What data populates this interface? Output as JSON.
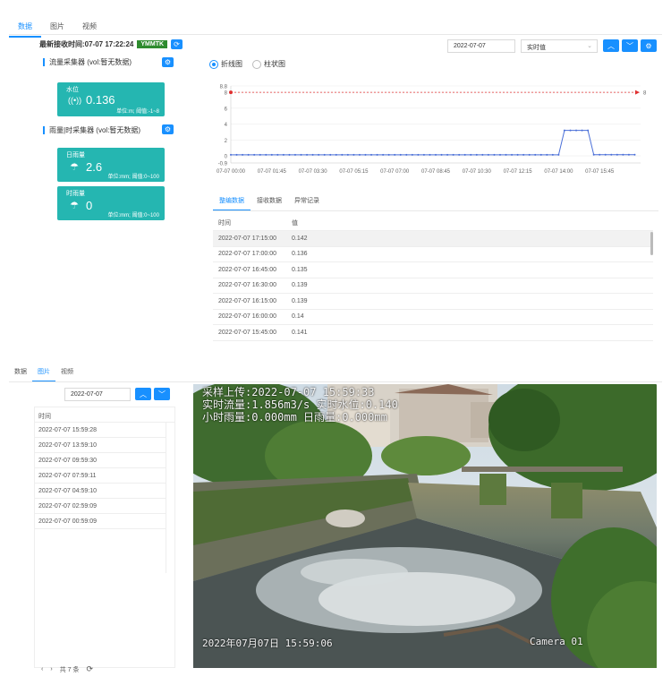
{
  "top": {
    "tabs": [
      "数据",
      "图片",
      "视频"
    ],
    "active_tab": 0,
    "latest_label": "最新接收时间:07-07 17:22:24",
    "station_code": "YMMTK",
    "flow_section": "流量采集器 (vol:暂无数据)",
    "rain_section": "雨量|时采集器 (vol:暂无数据)",
    "cards": [
      {
        "label": "水位",
        "value": "0.136",
        "unit": "单位:m;  阈值:-1~8"
      },
      {
        "label": "日雨量",
        "value": "2.6",
        "unit": "单位:mm;  阈值:0~100"
      },
      {
        "label": "时雨量",
        "value": "0",
        "unit": "单位:mm;  阈值:0~100"
      }
    ],
    "date": "2022-07-07",
    "mode": "实时值",
    "radio_line": "折线图",
    "radio_bar": "柱状图",
    "subtabs": [
      "整编数据",
      "接收数据",
      "异常记录"
    ],
    "table": {
      "headers": [
        "时间",
        "值"
      ],
      "rows": [
        [
          "2022-07-07 17:15:00",
          "0.142"
        ],
        [
          "2022-07-07 17:00:00",
          "0.136"
        ],
        [
          "2022-07-07 16:45:00",
          "0.135"
        ],
        [
          "2022-07-07 16:30:00",
          "0.139"
        ],
        [
          "2022-07-07 16:15:00",
          "0.139"
        ],
        [
          "2022-07-07 16:00:00",
          "0.14"
        ],
        [
          "2022-07-07 15:45:00",
          "0.141"
        ]
      ]
    }
  },
  "chart_data": {
    "type": "line",
    "x_ticks": [
      "07-07 00:00",
      "07-07 01:45",
      "07-07 03:30",
      "07-07 05:15",
      "07-07 07:00",
      "07-07 08:45",
      "07-07 10:30",
      "07-07 12:15",
      "07-07 14:00",
      "07-07 15:45"
    ],
    "y_ticks": [
      "8.8",
      "8",
      "6",
      "4",
      "2",
      "0",
      "-0.9"
    ],
    "ylim": [
      -0.9,
      8.8
    ],
    "threshold": 8,
    "threshold_label": "8",
    "start_hour": 0,
    "end_hour": 17.25,
    "step_hours": 0.25,
    "series": [
      {
        "values_by_hour": [
          [
            0,
            0.13
          ],
          [
            14.0,
            0.13
          ],
          [
            14.25,
            3.2
          ],
          [
            15.25,
            3.2
          ],
          [
            15.5,
            0.14
          ],
          [
            17.25,
            0.142
          ]
        ]
      }
    ]
  },
  "bottom": {
    "tabs": [
      "数据",
      "图片",
      "视频"
    ],
    "active_tab": 1,
    "date": "2022-07-07",
    "list_header": "时间",
    "list": [
      "2022-07-07 15:59:28",
      "2022-07-07 13:59:10",
      "2022-07-07 09:59:30",
      "2022-07-07 07:59:11",
      "2022-07-07 04:59:10",
      "2022-07-07 02:59:09",
      "2022-07-07 00:59:09"
    ],
    "total": "共 7 条",
    "osd": {
      "line1": "采样上传:2022-07-07 15:59:33",
      "line2": "实时流量:1.856m3/s   实时水位:0.140",
      "line3": "小时雨量:0.000mm    日雨量:0.000mm",
      "timestamp": "2022年07月07日 15:59:06",
      "cam": "Camera 01"
    }
  },
  "colors": {
    "accent": "#1890ff",
    "card": "#25b6b1",
    "badge": "#2e8b2e",
    "threshold": "#e03030",
    "line": "#4a6fd8"
  }
}
